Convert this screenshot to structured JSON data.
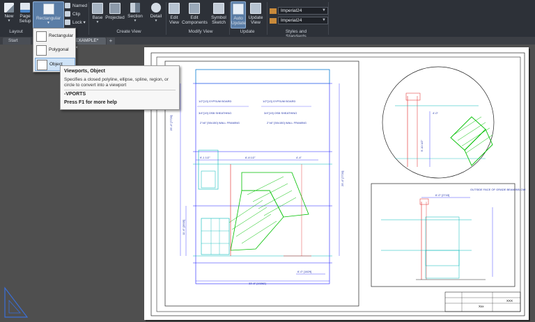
{
  "ribbon": {
    "new_label": "New",
    "page_setup_label": "Page\nSetup",
    "rectangular_label": "Rectangular",
    "named_label": "Named",
    "clip_label": "Clip",
    "lock_label": "Lock",
    "base_label": "Base",
    "projected_label": "Projected",
    "section_label": "Section",
    "detail_label": "Detail",
    "edit_view_label": "Edit\nView",
    "edit_components_label": "Edit\nComponents",
    "symbol_sketch_label": "Symbol\nSketch",
    "auto_update_label": "Auto\nUpdate",
    "update_view_label": "Update\nView",
    "style_combo_1": "Imperial24",
    "style_combo_2": "Imperial24",
    "panels": {
      "layout": "Layout",
      "create_view": "Create View",
      "modify_view": "Modify View",
      "update": "Update",
      "styles": "Styles and Standards"
    }
  },
  "tabs": {
    "start": "Start",
    "drawing": "EXAMPLE*"
  },
  "viewport_menu": {
    "items": [
      "Rectangular",
      "Polygonal",
      "Object"
    ]
  },
  "tooltip": {
    "title": "Viewports, Object",
    "description": "Specifies a closed polyline, ellipse, spline, region, or circle to convert into a viewport",
    "command": "-VPORTS",
    "help": "Press F1 for more help"
  },
  "drawing": {
    "dims": {
      "height_left": "25'-4\" [7720]",
      "height_right": "25'-4\" [7720]",
      "lower_height": "11'-6\" [3505]",
      "top_width": "6'-8 1/2\"",
      "width_9": "9'-1 1/2\"",
      "width_4": "4'-4\"",
      "width_small": "4'-0\"",
      "bottom_width": "33'-8\" [10262]",
      "bottom_small": "6'-0\" [1829]",
      "detail_width": "6'-0\" [2743]",
      "detail_height": "9'-10 1/2\"",
      "detail_small": "4'-0\""
    },
    "notes": {
      "gyp1": "1/2\"[13] GYPSUM BOARD",
      "gyp2": "1/2\"[13] GYPSUM BOARD",
      "osb1": "3/4\"[19] OSB SHEATHING",
      "osb2": "3/4\"[19] OSB SHEATHING",
      "wall1": "2\"x6\" [50x150] WALL FRAMING",
      "wall2": "2\"x6\" [50x150] WALL FRAMING",
      "outside_face": "OUTSIDE FACE OF GRADE BEAM BELOW"
    },
    "title_block": {
      "project": "Xxx",
      "sheet_label": "XXX"
    }
  },
  "colors": {
    "ribbon_bg": "#2d3138",
    "canvas_bg": "#4f4f4f",
    "paper": "#ffffff",
    "drawing_blue": "#1a1aff",
    "drawing_green": "#00c000",
    "drawing_cyan": "#00b8b8",
    "selected_button": "#5a7da6"
  }
}
